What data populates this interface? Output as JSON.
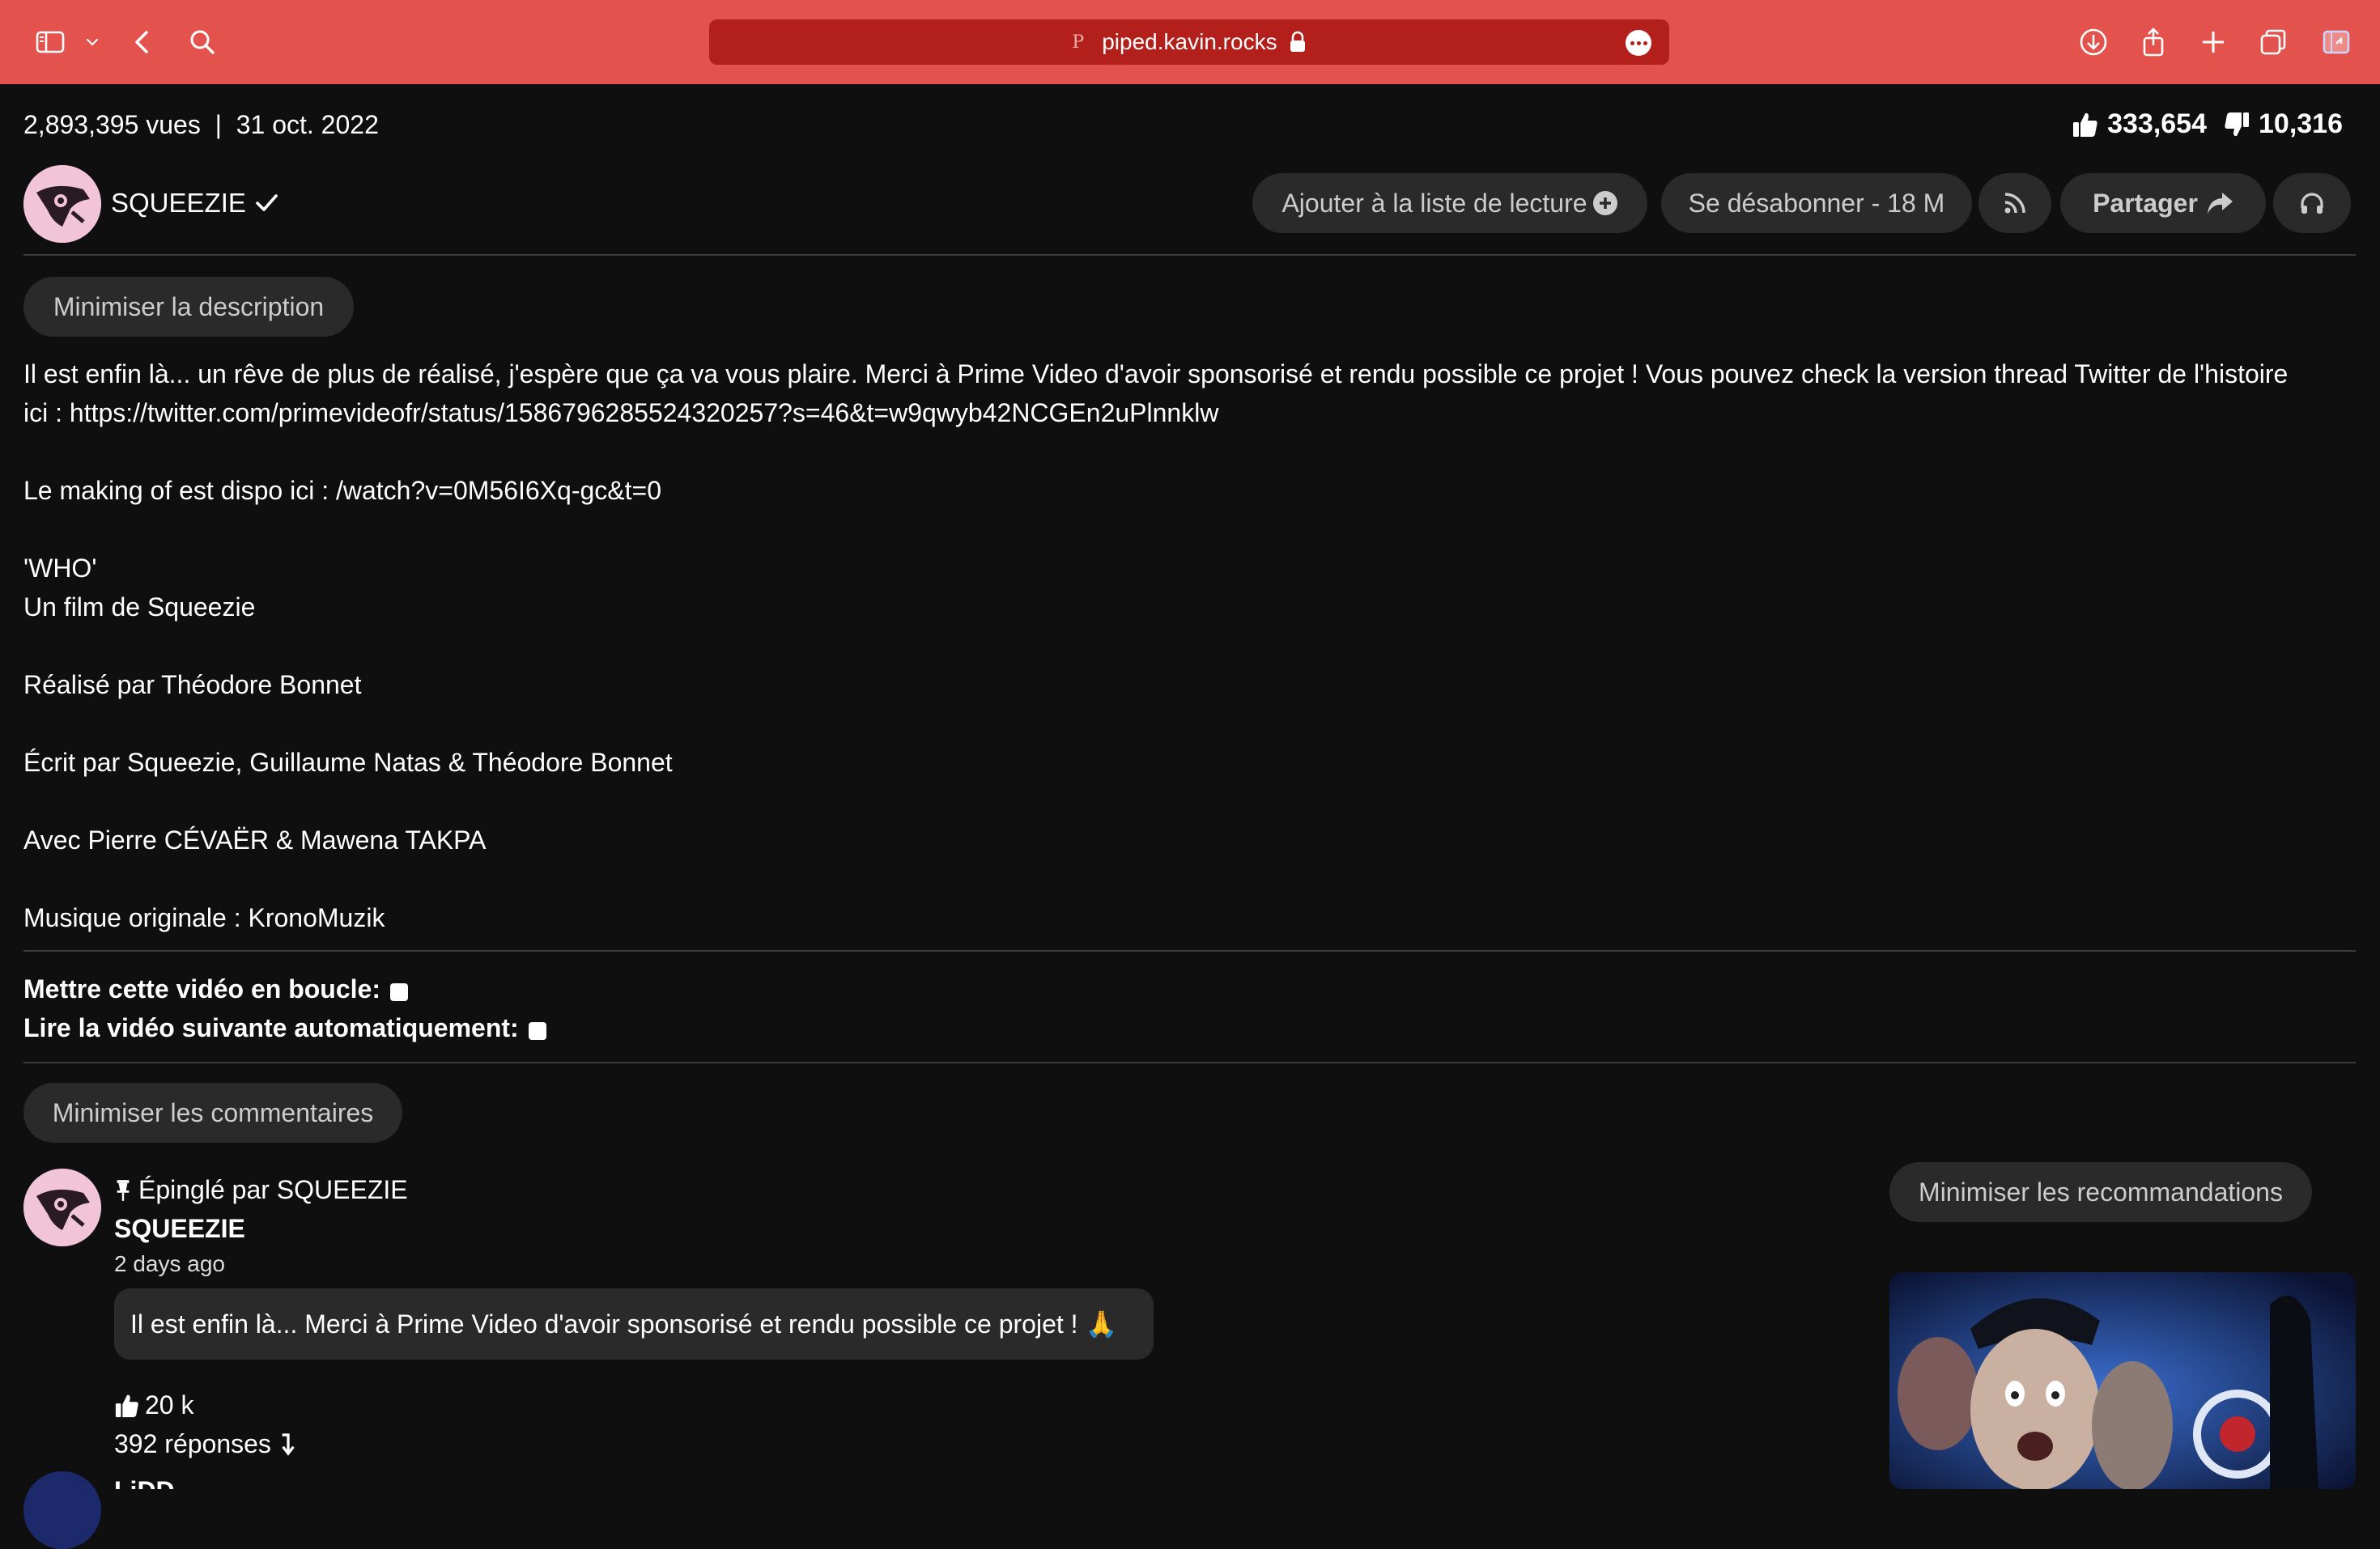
{
  "browser": {
    "url": "piped.kavin.rocks",
    "favicon": "P"
  },
  "video": {
    "views_date": "2,893,395 vues  |  31 oct. 2022",
    "likes": "333,654",
    "dislikes": "10,316"
  },
  "channel": {
    "name": "SQUEEZIE"
  },
  "actions": {
    "playlist": "Ajouter à la liste de lecture",
    "unsubscribe": "Se désabonner - 18 M",
    "share": "Partager"
  },
  "description": {
    "toggle": "Minimiser la description",
    "lines": [
      "Il est enfin là... un rêve de plus de réalisé, j'espère que ça va vous plaire. Merci à Prime Video d'avoir sponsorisé et rendu possible ce projet ! Vous pouvez check la version thread Twitter de l'histoire",
      "ici : https://twitter.com/primevideofr/status/1586796285524320257?s=46&t=w9qwyb42NCGEn2uPlnnklw",
      "Le making of est dispo ici : /watch?v=0M56I6Xq-gc&t=0",
      "'WHO'",
      "Un film de Squeezie",
      "Réalisé par Théodore Bonnet",
      "Écrit par Squeezie, Guillaume Natas & Théodore Bonnet",
      "Avec Pierre CÉVAËR & Mawena TAKPA",
      "Musique originale : KronoMuzik"
    ]
  },
  "options": {
    "loop": "Mettre cette vidéo en boucle:",
    "autoplay": "Lire la vidéo suivante automatiquement:"
  },
  "comments": {
    "toggle": "Minimiser les commentaires",
    "pinned": "Épinglé par SQUEEZIE",
    "author": "SQUEEZIE",
    "time": "2 days ago",
    "text": "Il est enfin là... Merci à Prime Video d'avoir sponsorisé et rendu possible ce projet ! 🙏",
    "likes": "20 k",
    "replies": "392 réponses",
    "next_author": "LiDD"
  },
  "recommendations": {
    "toggle": "Minimiser les recommandations"
  },
  "colors": {
    "toolbar": "#e4524d",
    "urlbar": "#b31f1b",
    "background": "#0f0f0f",
    "pill": "#2a2a2a"
  }
}
